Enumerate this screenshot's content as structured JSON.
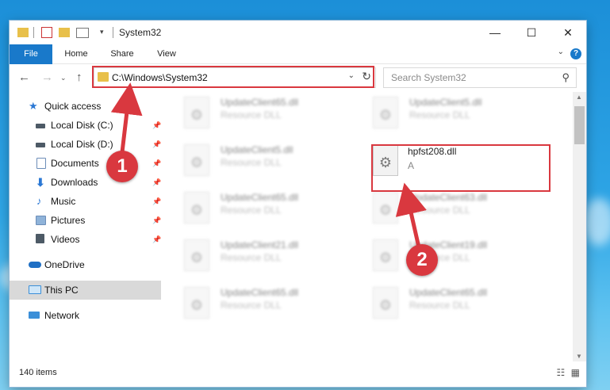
{
  "window": {
    "title": "System32",
    "controls": {
      "minimize": "—",
      "maximize": "☐",
      "close": "✕"
    }
  },
  "ribbon": {
    "tabs": [
      "File",
      "Home",
      "Share",
      "View"
    ],
    "help_label": "?"
  },
  "navbar": {
    "address": "C:\\Windows\\System32",
    "search_placeholder": "Search System32"
  },
  "sidebar": {
    "items": [
      {
        "label": "Quick access",
        "icon": "star-icon",
        "color": "#2b78d4"
      },
      {
        "label": "Local Disk (C:)",
        "icon": "drive-icon",
        "color": "#4d5a66",
        "pinned": true
      },
      {
        "label": "Local Disk (D:)",
        "icon": "drive-icon",
        "color": "#4d5a66",
        "pinned": true
      },
      {
        "label": "Documents",
        "icon": "documents-icon",
        "color": "#6c8db8",
        "pinned": true
      },
      {
        "label": "Downloads",
        "icon": "download-icon",
        "color": "#2b78d4",
        "pinned": true
      },
      {
        "label": "Music",
        "icon": "music-icon",
        "color": "#2b78d4",
        "pinned": true
      },
      {
        "label": "Pictures",
        "icon": "pictures-icon",
        "color": "#6c8db8",
        "pinned": true
      },
      {
        "label": "Videos",
        "icon": "videos-icon",
        "color": "#4d5a66",
        "pinned": true
      },
      {
        "label": "OneDrive",
        "icon": "cloud-icon",
        "color": "#1f6fc4"
      },
      {
        "label": "This PC",
        "icon": "computer-icon",
        "color": "#3b8fd8",
        "selected": true
      },
      {
        "label": "Network",
        "icon": "network-icon",
        "color": "#3b8fd8"
      }
    ]
  },
  "files": [
    {
      "name": "UpdateClient65.dll",
      "type": "Resource DLL",
      "blurred": true
    },
    {
      "name": "UpdateClient5.dll",
      "type": "Resource DLL",
      "blurred": true
    },
    {
      "name": "UpdateClient5.dll",
      "type": "Resource DLL",
      "blurred": true
    },
    {
      "name": "hpfst208.dll",
      "type": "A",
      "blurred": false
    },
    {
      "name": "UpdateClient65.dll",
      "type": "Resource DLL",
      "blurred": true
    },
    {
      "name": "UpdateClient63.dll",
      "type": "Resource DLL",
      "blurred": true
    },
    {
      "name": "UpdateClient21.dll",
      "type": "Resource DLL",
      "blurred": true
    },
    {
      "name": "UpdateClient19.dll",
      "type": "Resource DLL",
      "blurred": true
    },
    {
      "name": "UpdateClient65.dll",
      "type": "Resource DLL",
      "blurred": true
    },
    {
      "name": "UpdateClient65.dll",
      "type": "Resource DLL",
      "blurred": true
    }
  ],
  "status": {
    "item_count": "140 items"
  },
  "annotations": {
    "step1": "1",
    "step2": "2",
    "color": "#d9383f"
  }
}
